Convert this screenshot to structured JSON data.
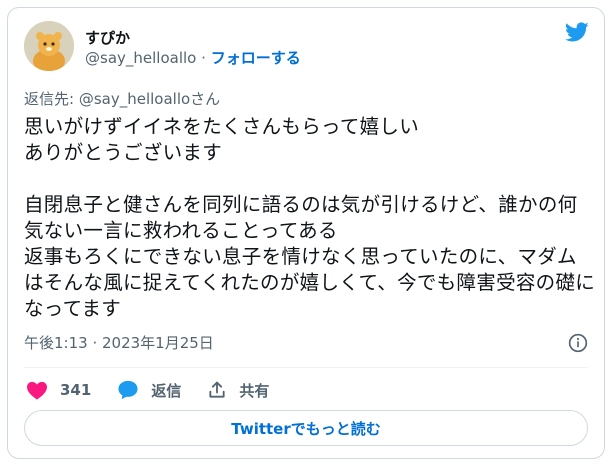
{
  "author": {
    "display_name": "すぴか",
    "handle": "@say_helloallo",
    "separator": "·",
    "follow_label": "フォローする"
  },
  "reply_to": {
    "prefix": "返信先: ",
    "handle": "@say_helloallo",
    "suffix": "さん"
  },
  "tweet_text": "思いがけずイイネをたくさんもらって嬉しい\nありがとうございます\n\n自閉息子と健さんを同列に語るのは気が引けるけど、誰かの何気ない一言に救われることってある\n返事もろくにできない息子を情けなく思っていたのに、マダムはそんな風に捉えてくれたのが嬉しくて、今でも障害受容の礎になってます",
  "timestamp": "午後1:13 · 2023年1月25日",
  "actions": {
    "like_count": "341",
    "reply_label": "返信",
    "share_label": "共有"
  },
  "read_more_label": "Twitterでもっと読む",
  "colors": {
    "twitter_blue": "#1d9bf0",
    "link_blue": "#006fd6",
    "like_pink": "#f91880",
    "muted": "#536471"
  },
  "icons": [
    "twitter-bird-icon",
    "info-icon",
    "heart-icon",
    "reply-bubble-icon",
    "share-icon"
  ]
}
